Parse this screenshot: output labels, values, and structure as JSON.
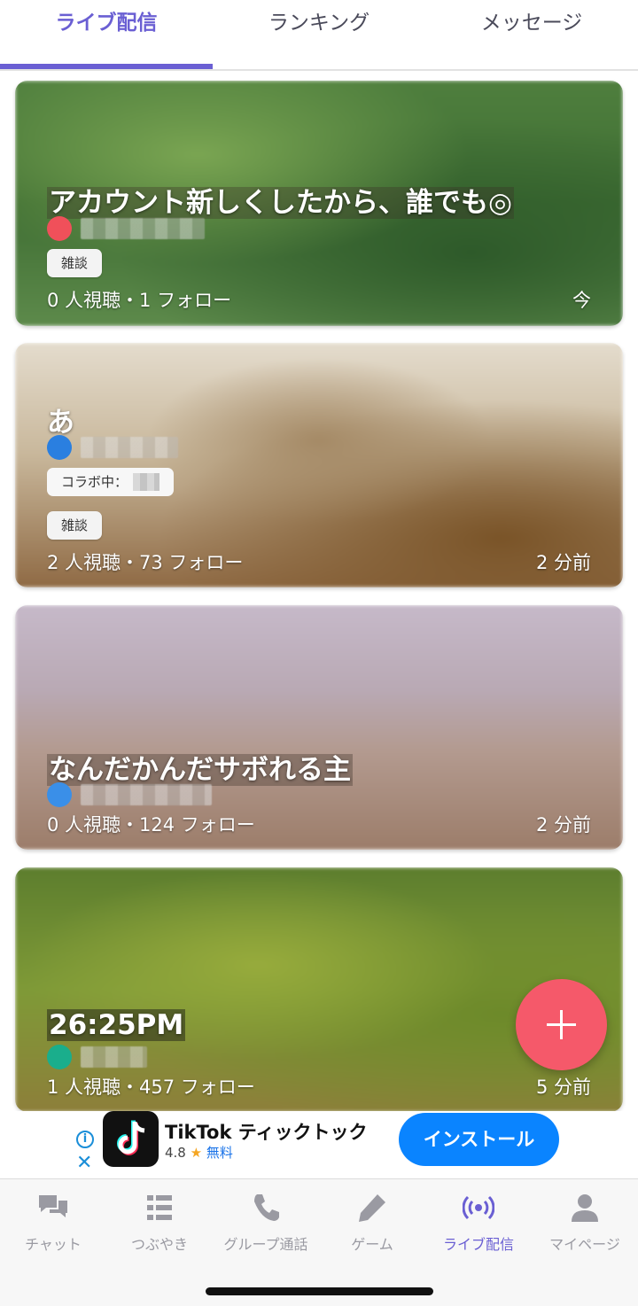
{
  "top_tabs": [
    {
      "label": "ライブ配信",
      "active": true
    },
    {
      "label": "ランキング",
      "active": false
    },
    {
      "label": "メッセージ",
      "active": false
    }
  ],
  "streams": [
    {
      "title": "アカウント新しくしたから、誰でも◎",
      "avatar_color": "#f0505a",
      "tag": "雑談",
      "stats": "0 人視聴・1 フォロー",
      "time": "今"
    },
    {
      "title": "あ",
      "avatar_color": "#2a7fe0",
      "collab_label": "コラボ中：",
      "tag": "雑談",
      "stats": "2 人視聴・73 フォロー",
      "time": "2 分前"
    },
    {
      "title": "なんだかんだサボれる主",
      "avatar_color": "#3a8fe8",
      "stats": "0 人視聴・124 フォロー",
      "time": "2 分前"
    },
    {
      "title": "26:25PM",
      "avatar_color": "#1aae8c",
      "stats": "1 人視聴・457 フォロー",
      "time": "5 分前"
    }
  ],
  "fab": {
    "icon": "plus-icon",
    "color": "#f5596a"
  },
  "ad": {
    "app_name": "TikTok ティックトック",
    "rating": "4.8",
    "star": "★",
    "price": "無料",
    "install_label": "インストール",
    "info_icon": "i",
    "close_icon": "✕"
  },
  "bottom_nav": [
    {
      "label": "チャット",
      "icon": "chat-icon",
      "active": false
    },
    {
      "label": "つぶやき",
      "icon": "list-icon",
      "active": false
    },
    {
      "label": "グループ通話",
      "icon": "phone-icon",
      "active": false
    },
    {
      "label": "ゲーム",
      "icon": "pencil-icon",
      "active": false
    },
    {
      "label": "ライブ配信",
      "icon": "broadcast-icon",
      "active": true
    },
    {
      "label": "マイページ",
      "icon": "person-icon",
      "active": false
    }
  ],
  "colors": {
    "accent": "#6a5fd3",
    "inactive": "#9a9aa2",
    "install": "#0a84ff"
  }
}
